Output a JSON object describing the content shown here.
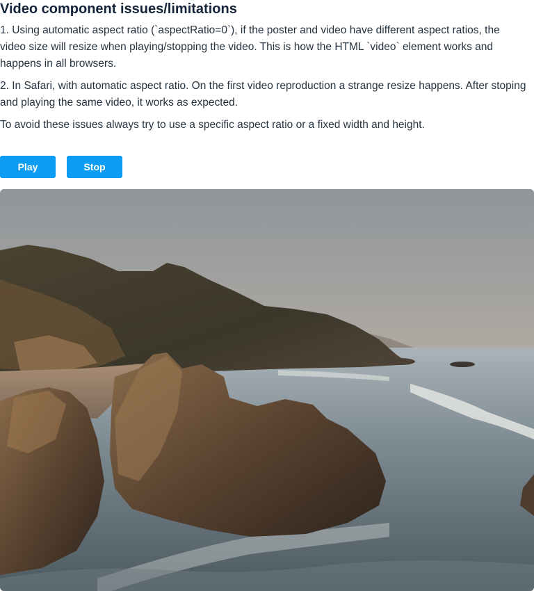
{
  "heading": "Video component issues/limitations",
  "paragraphs": [
    "1. Using automatic aspect ratio (`aspectRatio=0`), if the poster and video have different aspect ratios, the video size will resize when playing/stopping the video. This is how the HTML `video` element works and happens in all browsers.",
    "2. In Safari, with automatic aspect ratio. On the first video reproduction a strange resize happens. After stoping and playing the same video, it works as expected.",
    "To avoid these issues always try to use a specific aspect ratio or a fixed width and height."
  ],
  "controls": {
    "play_label": "Play",
    "stop_label": "Stop"
  },
  "colors": {
    "button": "#0c9cf2",
    "heading": "#14243a"
  }
}
